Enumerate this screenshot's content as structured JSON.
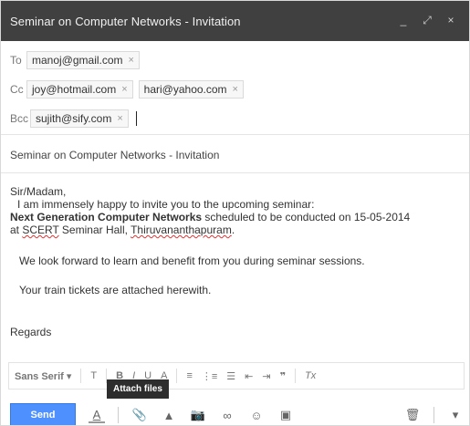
{
  "window": {
    "title": "Seminar on Computer Networks - Invitation",
    "controls": {
      "minimize": "_",
      "expand": "⤢",
      "close": "×"
    }
  },
  "recipients": {
    "to": {
      "label": "To",
      "chips": [
        "manoj@gmail.com"
      ]
    },
    "cc": {
      "label": "Cc",
      "chips": [
        "joy@hotmail.com",
        "hari@yahoo.com"
      ]
    },
    "bcc": {
      "label": "Bcc",
      "chips": [
        "sujith@sify.com"
      ]
    },
    "remove_glyph": "×"
  },
  "subject": "Seminar on Computer Networks - Invitation",
  "body": {
    "greeting": "Sir/Madam,",
    "line1": "I am immensely happy to invite you to the upcoming seminar:",
    "line2_bold": "Next Generation Computer Networks",
    "line2_rest": " scheduled to be conducted on 15-05-2014",
    "line3_pre": "at ",
    "line3_scert": "SCERT",
    "line3_mid": " Seminar Hall, ",
    "line3_place": "Thiruvananthapuram",
    "line3_end": ".",
    "para2": "We look forward to learn and benefit from you during seminar sessions.",
    "para3": "Your train tickets are attached herewith.",
    "closing": "Regards"
  },
  "formatting": {
    "font": "Sans Serif",
    "dropdown": "▾",
    "size": "T",
    "bold": "B",
    "italic": "I",
    "underline": "U",
    "text_color": "A",
    "align": "≡",
    "numbered_list": "⋮≡",
    "bullet_list": "☰",
    "indent_less": "⇤",
    "indent_more": "⇥",
    "quote": "❞",
    "remove_format": "Tx"
  },
  "tooltip": "Attach files",
  "bottom": {
    "send": "Send",
    "formatting_icon": "A",
    "attach_icon": "📎",
    "drive_icon": "▲",
    "photo_icon": "📷",
    "link_icon": "∞",
    "emoji_icon": "☺",
    "invite_icon": "▣",
    "trash_icon": "🗑",
    "more_icon": "▾"
  },
  "colors": {
    "titlebar": "#404040",
    "send": "#4d90fe",
    "tooltip": "#2d2d2d"
  }
}
